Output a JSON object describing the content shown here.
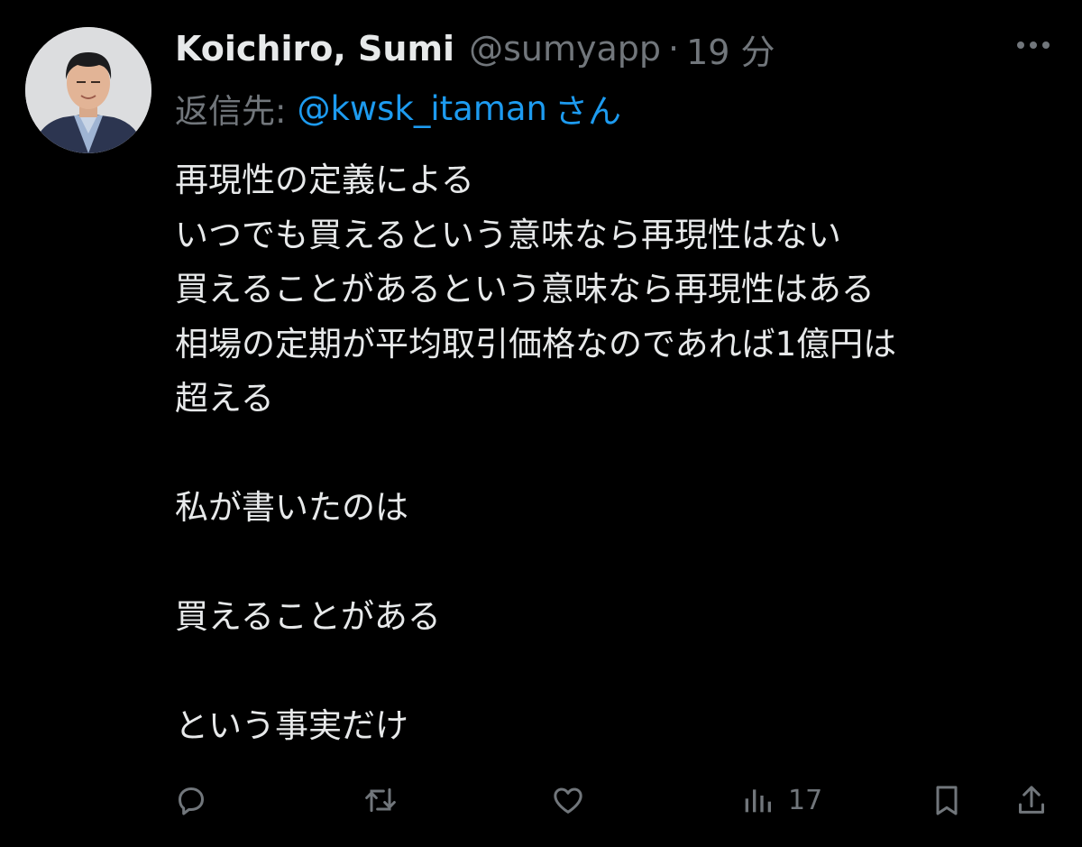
{
  "tweet": {
    "display_name": "Koichiro, Sumi",
    "handle": "@sumyapp",
    "separator": "·",
    "time": "19 分",
    "reply_prefix": "返信先:",
    "reply_user": "@kwsk_itaman",
    "reply_suffix": "さん",
    "body_lines": [
      "再現性の定義による",
      "いつでも買えるという意味なら再現性はない",
      "買えることがあるという意味なら再現性はある",
      "相場の定期が平均取引価格なのであれば1億円は",
      "超える",
      "",
      "私が書いたのは",
      "",
      "買えることがある",
      "",
      "という事実だけ"
    ]
  },
  "actions": {
    "reply_icon": "reply-icon",
    "retweet_icon": "retweet-icon",
    "like_icon": "like-icon",
    "views_icon": "views-icon",
    "views_count": "17",
    "bookmark_icon": "bookmark-icon",
    "share_icon": "share-icon"
  },
  "colors": {
    "background": "#000000",
    "text": "#e7e9ea",
    "muted": "#71767b",
    "link": "#1d9bf0"
  }
}
